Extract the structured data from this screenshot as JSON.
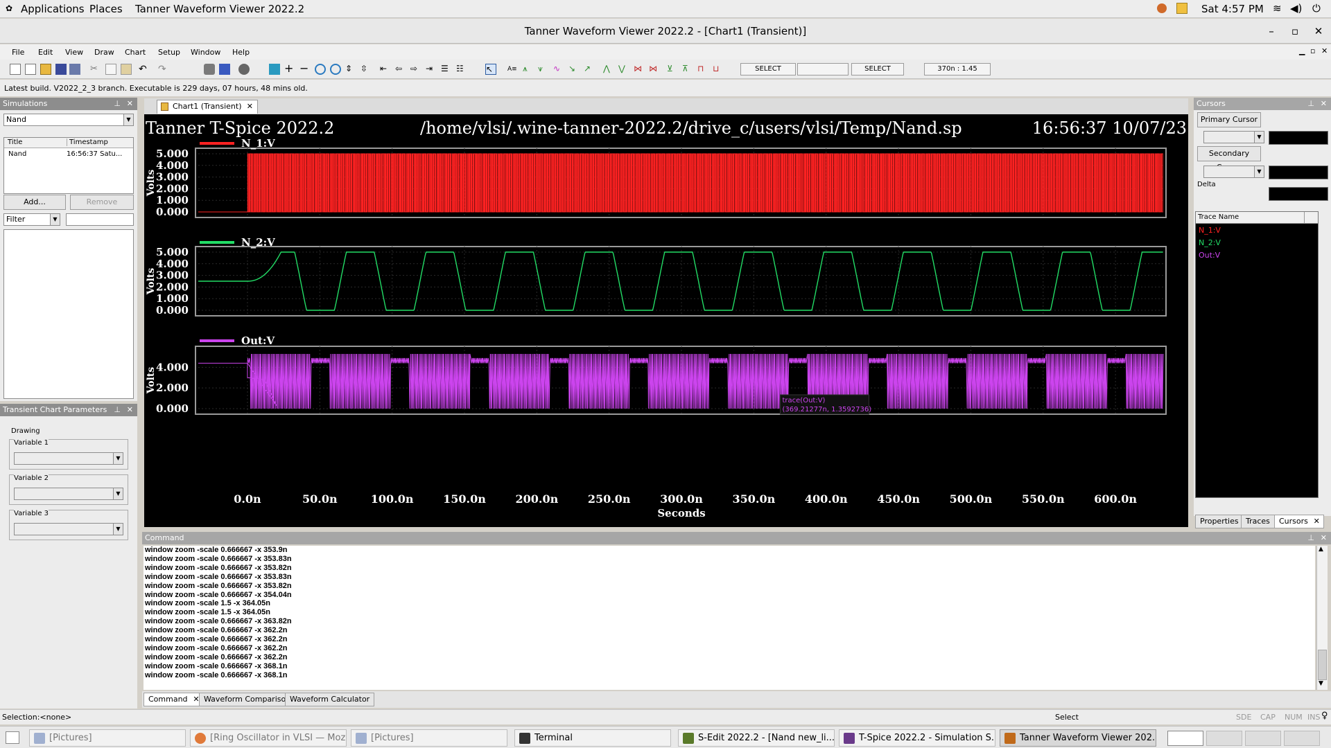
{
  "topbar": {
    "applications": "Applications",
    "places": "Places",
    "active_app": "Tanner Waveform Viewer 2022.2",
    "clock": "Sat  4:57 PM"
  },
  "window": {
    "title": "Tanner Waveform Viewer 2022.2 - [Chart1 (Transient)]",
    "minimize": "–",
    "maximize": "▫",
    "close": "✕"
  },
  "menu": [
    "File",
    "Edit",
    "View",
    "Draw",
    "Chart",
    "Setup",
    "Window",
    "Help"
  ],
  "toolbar": {
    "select1": "SELECT",
    "select2": "SELECT",
    "coord": "370n : 1.45"
  },
  "build_info": "Latest build. V2022_2_3 branch. Executable is 229 days, 07 hours, 48 mins old.",
  "simulations": {
    "header": "Simulations",
    "selected": "Nand",
    "columns": [
      "Title",
      "Timestamp"
    ],
    "rows": [
      {
        "title": "Nand",
        "timestamp": "16:56:37 Satu..."
      }
    ],
    "add": "Add...",
    "remove": "Remove",
    "filter": "Filter"
  },
  "params": {
    "header": "Transient Chart Parameters",
    "drawing": "Drawing",
    "var1": "Variable 1",
    "var2": "Variable 2",
    "var3": "Variable 3"
  },
  "tab": {
    "label": "Chart1 (Transient)",
    "close": "✕"
  },
  "chart_header": {
    "left": "Tanner T-Spice 2022.2",
    "center": "/home/vlsi/.wine-tanner-2022.2/drive_c/users/vlsi/Temp/Nand.sp",
    "right": "16:56:37 10/07/23"
  },
  "colors": {
    "n1": "#ff2222",
    "n2": "#22dd66",
    "out": "#cc44ee",
    "bg": "#000000"
  },
  "chart_data": [
    {
      "type": "line",
      "series": [
        {
          "name": "N_1:V"
        }
      ],
      "ylabel": "Volts",
      "yticks": [
        "5.000",
        "4.000",
        "3.000",
        "2.000",
        "1.000",
        "0.000"
      ],
      "ylim": [
        0,
        5
      ],
      "note_start_ns": 0,
      "signal_range_v": [
        0,
        5
      ]
    },
    {
      "type": "line",
      "series": [
        {
          "name": "N_2:V",
          "period_ns": 55,
          "first_peak_ns": 23,
          "initial_v": 2.5
        }
      ],
      "ylabel": "Volts",
      "yticks": [
        "5.000",
        "4.000",
        "3.000",
        "2.000",
        "1.000",
        "0.000"
      ],
      "ylim": [
        0,
        5
      ]
    },
    {
      "type": "line",
      "series": [
        {
          "name": "Out:V"
        }
      ],
      "ylabel": "Volts",
      "yticks": [
        "4.000",
        "2.000",
        "0.000"
      ],
      "ylim": [
        0,
        5.5
      ],
      "xlabel": "Seconds",
      "xticks": [
        "0.0n",
        "50.0n",
        "100.0n",
        "150.0n",
        "200.0n",
        "250.0n",
        "300.0n",
        "350.0n",
        "400.0n",
        "450.0n",
        "500.0n",
        "550.0n",
        "600.0n"
      ],
      "xlim": [
        -34,
        633
      ],
      "tooltip": {
        "line1": "trace(Out:V)",
        "line2": "(369.21277n, 1.3592736)"
      }
    }
  ],
  "cursors": {
    "header": "Cursors",
    "primary": "Primary Cursor",
    "secondary": "Secondary Cursor",
    "delta": "Delta",
    "trace_header": "Trace Name",
    "traces": [
      "N_1:V",
      "N_2:V",
      "Out:V"
    ],
    "tabs": [
      "Properties",
      "Traces",
      "Cursors"
    ]
  },
  "command": {
    "header": "Command",
    "lines": [
      "window zoom -scale 0.666667 -x 353.9n",
      "window zoom -scale 0.666667 -x 353.83n",
      "window zoom -scale 0.666667 -x 353.82n",
      "window zoom -scale 0.666667 -x 353.83n",
      "window zoom -scale 0.666667 -x 353.82n",
      "window zoom -scale 0.666667 -x 354.04n",
      "window zoom -scale 1.5 -x 364.05n",
      "window zoom -scale 1.5 -x 364.05n",
      "window zoom -scale 0.666667 -x 363.82n",
      "window zoom -scale 0.666667 -x 362.2n",
      "window zoom -scale 0.666667 -x 362.2n",
      "window zoom -scale 0.666667 -x 362.2n",
      "window zoom -scale 0.666667 -x 362.2n",
      "window zoom -scale 0.666667 -x 368.1n",
      "window zoom -scale 0.666667 -x 368.1n"
    ],
    "tabs": [
      "Command",
      "Waveform Comparison",
      "Waveform Calculator"
    ]
  },
  "status": {
    "selection": "Selection:<none>",
    "mode": "Select",
    "indicators": [
      "SDE",
      "CAP",
      "NUM",
      "INS"
    ]
  },
  "taskbar": [
    "[Pictures]",
    "[Ring Oscillator in VLSI — Moz...",
    "[Pictures]",
    "Terminal",
    "S-Edit 2022.2 - [Nand new_li...",
    "T-Spice 2022.2 - Simulation S...",
    "Tanner Waveform Viewer 202..."
  ]
}
